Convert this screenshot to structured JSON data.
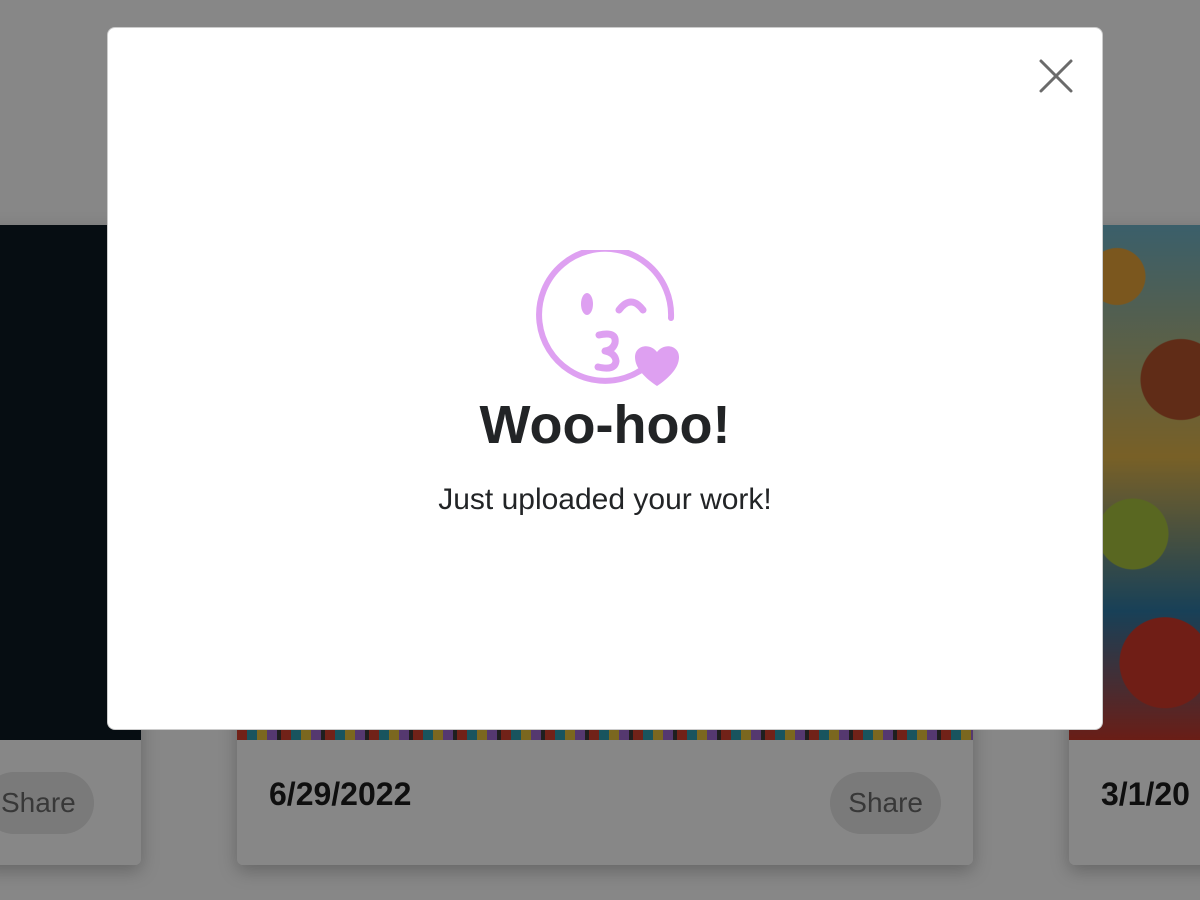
{
  "background": {
    "cards": [
      {
        "date": "",
        "share_label": "Share"
      },
      {
        "date": "6/29/2022",
        "share_label": "Share"
      },
      {
        "date": "3/1/20",
        "share_label": ""
      }
    ]
  },
  "modal": {
    "icon": "kissing-face-heart-icon",
    "icon_color": "#dea0f1",
    "title": "Woo-hoo!",
    "message": "Just uploaded your work!",
    "close_icon": "close-icon"
  },
  "colors": {
    "overlay": "rgba(0,0,0,0.47)",
    "text": "#222426",
    "close_icon": "#6b6b6b"
  }
}
